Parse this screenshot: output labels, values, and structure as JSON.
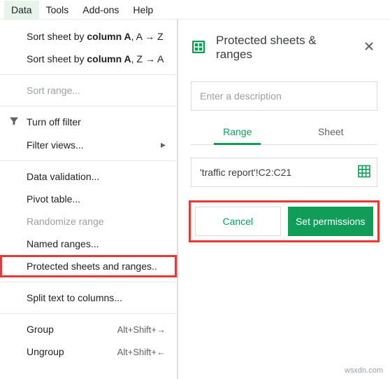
{
  "menubar": {
    "items": [
      "Data",
      "Tools",
      "Add-ons",
      "Help"
    ],
    "active_index": 0
  },
  "data_menu": {
    "sort_asc_prefix": "Sort sheet by ",
    "sort_asc_col": "column A",
    "sort_asc_suffix": ", A → Z",
    "sort_desc_prefix": "Sort sheet by ",
    "sort_desc_col": "column A",
    "sort_desc_suffix": ", Z → A",
    "sort_range": "Sort range...",
    "turn_off_filter": "Turn off filter",
    "filter_views": "Filter views...",
    "data_validation": "Data validation...",
    "pivot_table": "Pivot table...",
    "randomize_range": "Randomize range",
    "named_ranges": "Named ranges...",
    "protected_sheets": "Protected sheets and ranges..",
    "split_text": "Split text to columns...",
    "group": "Group",
    "group_shortcut": "Alt+Shift+→",
    "ungroup": "Ungroup",
    "ungroup_shortcut": "Alt+Shift+←"
  },
  "panel": {
    "title": "Protected sheets & ranges",
    "desc_placeholder": "Enter a description",
    "tabs": {
      "range": "Range",
      "sheet": "Sheet"
    },
    "range_value": "'traffic report'!C2:C21",
    "cancel": "Cancel",
    "set_permissions": "Set permissions"
  },
  "colors": {
    "accent_green": "#0f9d58",
    "highlight_red": "#e53935"
  },
  "watermark": "wsxdn.com"
}
